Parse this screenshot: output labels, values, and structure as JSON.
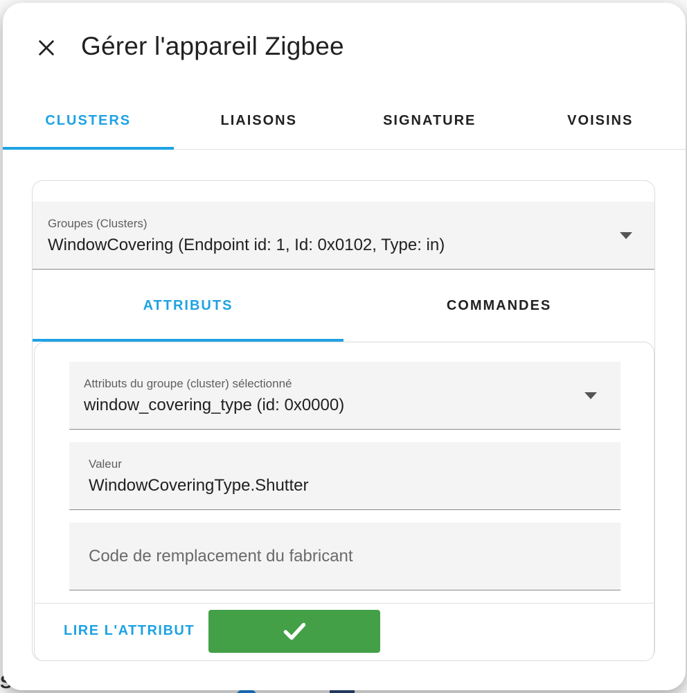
{
  "dialog": {
    "title": "Gérer l'appareil Zigbee",
    "close_icon": "close-icon"
  },
  "main_tabs": [
    {
      "label": "CLUSTERS",
      "active": true
    },
    {
      "label": "LIAISONS",
      "active": false
    },
    {
      "label": "SIGNATURE",
      "active": false
    },
    {
      "label": "VOISINS",
      "active": false
    }
  ],
  "cluster_select": {
    "label": "Groupes (Clusters)",
    "value": "WindowCovering (Endpoint id: 1, Id: 0x0102, Type: in)"
  },
  "sub_tabs": [
    {
      "label": "ATTRIBUTS",
      "active": true
    },
    {
      "label": "COMMANDES",
      "active": false
    }
  ],
  "attribute_select": {
    "label": "Attributs du groupe (cluster) sélectionné",
    "value": "window_covering_type (id: 0x0000)"
  },
  "value_field": {
    "label": "Valeur",
    "value": "WindowCoveringType.Shutter"
  },
  "manufacturer_field": {
    "placeholder": "Code de remplacement du fabricant",
    "value": ""
  },
  "actions": {
    "read_label": "LIRE L'ATTRIBUT",
    "confirm_icon": "checkmark-icon"
  },
  "colors": {
    "accent": "#1ea2e4",
    "confirm": "#43a047",
    "field_bg": "#f4f4f4"
  }
}
